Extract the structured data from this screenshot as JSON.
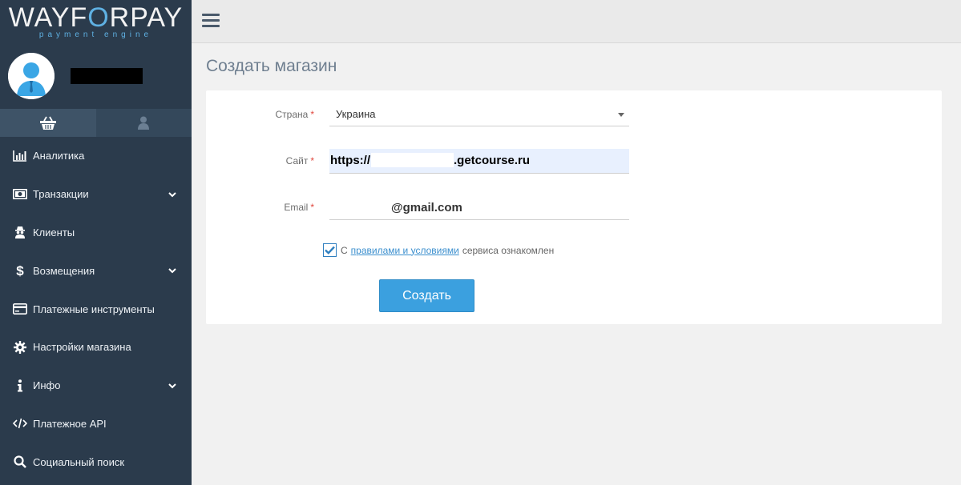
{
  "brand": {
    "logo_part1": "WAYF",
    "logo_accent": "O",
    "logo_part2": "RPAY",
    "tagline": "payment engine",
    "accent_color": "#5fb1e3"
  },
  "sidebar": {
    "tabs": [
      {
        "icon": "basket-icon",
        "active": true
      },
      {
        "icon": "user-icon",
        "active": false
      }
    ],
    "items": [
      {
        "label": "Аналитика",
        "icon": "bar-chart-icon",
        "has_submenu": false
      },
      {
        "label": "Транзакции",
        "icon": "money-icon",
        "has_submenu": true
      },
      {
        "label": "Клиенты",
        "icon": "spy-icon",
        "has_submenu": false
      },
      {
        "label": "Возмещения",
        "icon": "dollar-icon",
        "has_submenu": true
      },
      {
        "label": "Платежные инструменты",
        "icon": "credit-card-icon",
        "has_submenu": false
      },
      {
        "label": "Настройки магазина",
        "icon": "gear-icon",
        "has_submenu": false
      },
      {
        "label": "Инфо",
        "icon": "info-icon",
        "has_submenu": true
      },
      {
        "label": "Платежное API",
        "icon": "code-icon",
        "has_submenu": false
      },
      {
        "label": "Социальный поиск",
        "icon": "search-icon",
        "has_submenu": false
      }
    ]
  },
  "page": {
    "title": "Создать магазин"
  },
  "form": {
    "country_label": "Страна",
    "country_value": "Украина",
    "site_label": "Сайт",
    "site_prefix": "https://",
    "site_suffix": ".getcourse.ru",
    "email_label": "Email",
    "email_value": "@gmail.com",
    "required_mark": "*",
    "agree_prefix": "С",
    "agree_link": "правилами и условиями",
    "agree_suffix": "сервиса ознакомлен",
    "agree_checked": true,
    "submit_label": "Создать"
  }
}
